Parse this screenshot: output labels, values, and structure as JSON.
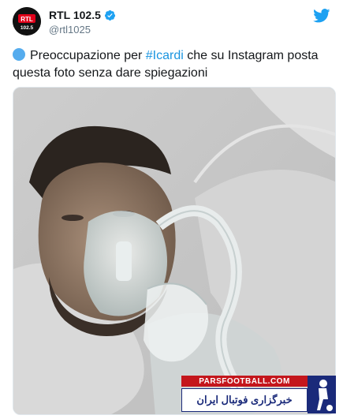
{
  "account": {
    "display_name": "RTL 102.5",
    "handle": "@rtl1025",
    "avatar_text": "RTL",
    "avatar_subtext": "102.5"
  },
  "tweet": {
    "text_before": "Preoccupazione per ",
    "hashtag": "#Icardi",
    "text_after": " che su Instagram posta questa foto senza dare spiegazioni"
  },
  "watermark": {
    "site": "PARSFOOTBALL.COM",
    "persian": "خبرگزاری فوتبال ایران"
  },
  "icons": {
    "verified": "verified-badge-icon",
    "twitter": "twitter-bird-icon",
    "circle": "blue-circle-emoji"
  },
  "colors": {
    "link": "#1b95e0",
    "twitter_blue": "#1da1f2",
    "watermark_red": "#c4161c",
    "watermark_blue": "#1a2a7a"
  }
}
